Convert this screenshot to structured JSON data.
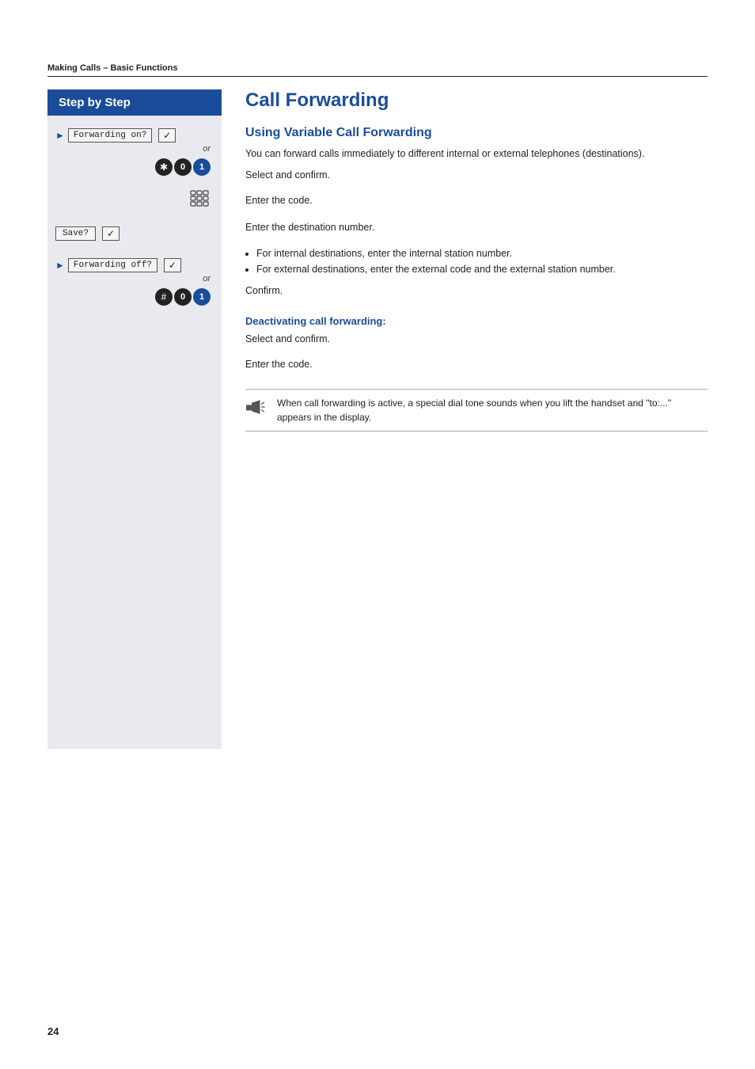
{
  "page": {
    "number": "24",
    "section_header": "Making Calls – Basic Functions"
  },
  "step_by_step": {
    "header": "Step by Step"
  },
  "content": {
    "main_title": "Call Forwarding",
    "sub_title": "Using Variable Call Forwarding",
    "intro_text": "You can forward calls immediately to different internal or external telephones (destinations).",
    "steps": [
      {
        "left_label": "Forwarding on?",
        "right_text": "Select and confirm.",
        "has_check": true,
        "has_or": true
      },
      {
        "icons": [
          "*",
          "0",
          "1"
        ],
        "right_text": "Enter the code."
      },
      {
        "has_keypad": true,
        "right_text": "Enter the destination number."
      },
      {
        "left_label": "Save?",
        "right_text": "Confirm.",
        "has_check": true
      }
    ],
    "deactivating_title": "Deactivating call forwarding:",
    "deactivating_steps": [
      {
        "left_label": "Forwarding off?",
        "right_text": "Select and confirm.",
        "has_check": true,
        "has_or": true
      },
      {
        "icons": [
          "#",
          "0",
          "1"
        ],
        "right_text": "Enter the code."
      }
    ],
    "bullet_items": [
      "For internal destinations, enter the internal station number.",
      "For external destinations, enter the external code and the external station number."
    ],
    "note_text": "When call forwarding is active, a special dial tone sounds when you lift the handset and \"to:...\" appears in the display."
  }
}
